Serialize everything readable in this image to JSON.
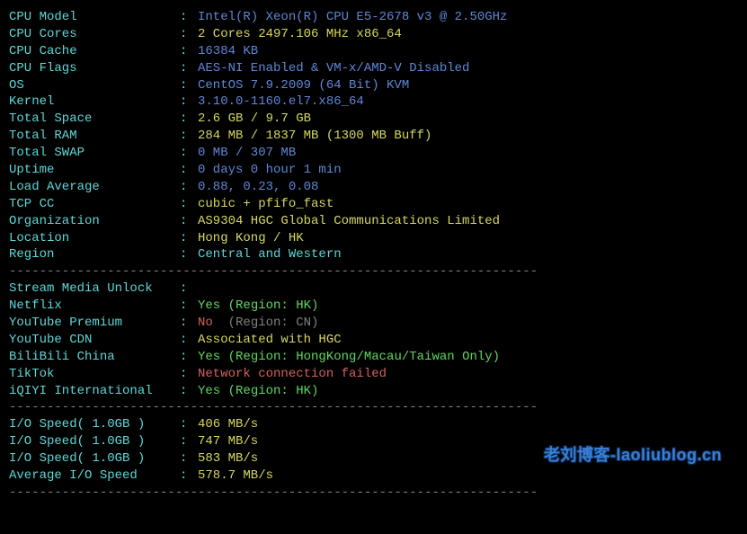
{
  "sys": {
    "cpu_model": {
      "label": "CPU Model",
      "value": "Intel(R) Xeon(R) CPU E5-2678 v3 @ 2.50GHz",
      "cls": "val-blue"
    },
    "cpu_cores": {
      "label": "CPU Cores",
      "value": "2 Cores 2497.106 MHz x86_64",
      "cls": "val-yellow"
    },
    "cpu_cache": {
      "label": "CPU Cache",
      "value": "16384 KB",
      "cls": "val-blue"
    },
    "cpu_flags": {
      "label": "CPU Flags",
      "value": "AES-NI Enabled & VM-x/AMD-V Disabled",
      "cls": "val-blue"
    },
    "os": {
      "label": "OS",
      "value": "CentOS 7.9.2009 (64 Bit) KVM",
      "cls": "val-blue"
    },
    "kernel": {
      "label": "Kernel",
      "value": "3.10.0-1160.el7.x86_64",
      "cls": "val-blue"
    },
    "total_space": {
      "label": "Total Space",
      "value": "2.6 GB / 9.7 GB",
      "cls": "val-yellow"
    },
    "total_ram": {
      "label": "Total RAM",
      "value": "284 MB / 1837 MB (1300 MB Buff)",
      "cls": "val-yellow"
    },
    "total_swap": {
      "label": "Total SWAP",
      "value": "0 MB / 307 MB",
      "cls": "val-blue"
    },
    "uptime": {
      "label": "Uptime",
      "value": "0 days 0 hour 1 min",
      "cls": "val-blue"
    },
    "load_avg": {
      "label": "Load Average",
      "value": "0.88, 0.23, 0.08",
      "cls": "val-blue"
    },
    "tcp_cc": {
      "label": "TCP CC",
      "value": "cubic + pfifo_fast",
      "cls": "val-yellow"
    },
    "organization": {
      "label": "Organization",
      "value": "AS9304 HGC Global Communications Limited",
      "cls": "val-yellow"
    },
    "location": {
      "label": "Location",
      "value": "Hong Kong / HK",
      "cls": "val-yellow"
    },
    "region": {
      "label": "Region",
      "value": "Central and Western",
      "cls": "val-cyan"
    }
  },
  "stream_header": {
    "label": "Stream Media Unlock",
    "value": "",
    "cls": ""
  },
  "stream": {
    "netflix": {
      "label": "Netflix",
      "value_a": "Yes",
      "value_b": " (Region: HK)",
      "cls_a": "val-green",
      "cls_b": "val-green"
    },
    "yt_prem": {
      "label": "YouTube Premium",
      "value_a": "No ",
      "value_b": " (Region: CN)",
      "cls_a": "val-red",
      "cls_b": "val-grey"
    },
    "yt_cdn": {
      "label": "YouTube CDN",
      "value_a": "Associated with HGC",
      "value_b": "",
      "cls_a": "val-yellow",
      "cls_b": ""
    },
    "bilibili": {
      "label": "BiliBili China",
      "value_a": "Yes",
      "value_b": " (Region: HongKong/Macau/Taiwan Only)",
      "cls_a": "val-green",
      "cls_b": "val-green"
    },
    "tiktok": {
      "label": "TikTok",
      "value_a": "Network connection failed",
      "value_b": "",
      "cls_a": "val-red",
      "cls_b": ""
    },
    "iqiyi": {
      "label": "iQIYI International",
      "value_a": "Yes",
      "value_b": " (Region: HK)",
      "cls_a": "val-green",
      "cls_b": "val-green"
    }
  },
  "io": {
    "test1": {
      "label": "I/O Speed( 1.0GB )",
      "value": "406 MB/s",
      "cls": "val-yellow"
    },
    "test2": {
      "label": "I/O Speed( 1.0GB )",
      "value": "747 MB/s",
      "cls": "val-yellow"
    },
    "test3": {
      "label": "I/O Speed( 1.0GB )",
      "value": "583 MB/s",
      "cls": "val-yellow"
    },
    "avg": {
      "label": "Average I/O Speed",
      "value": "578.7 MB/s",
      "cls": "val-yellow"
    }
  },
  "divider": "----------------------------------------------------------------------",
  "watermark": "老刘博客-laoliublog.cn"
}
